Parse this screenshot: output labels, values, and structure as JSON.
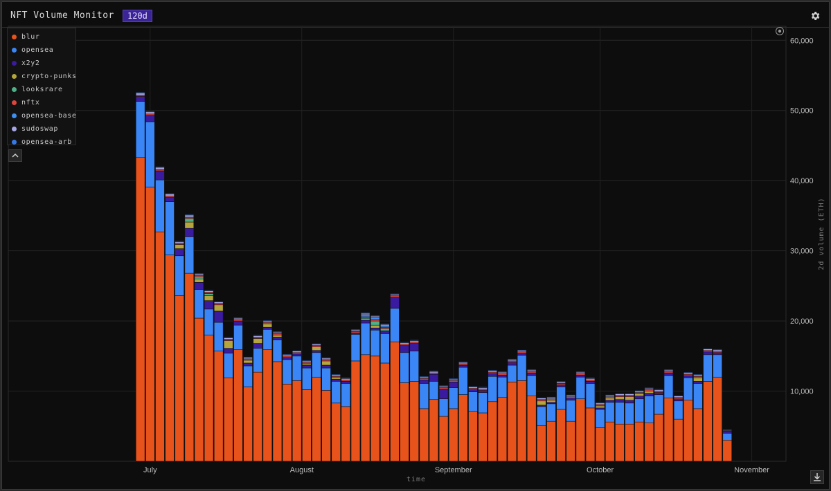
{
  "header": {
    "title": "NFT Volume Monitor",
    "range": "120d"
  },
  "icons": {
    "settings": "gear-icon",
    "collapse": "chevron-up-icon",
    "download": "download-icon",
    "reset": "target-icon"
  },
  "legend": [
    {
      "name": "blur",
      "color": "#e8531c"
    },
    {
      "name": "opensea",
      "color": "#3a86f7"
    },
    {
      "name": "x2y2",
      "color": "#3a1a9e"
    },
    {
      "name": "crypto-punks",
      "color": "#b4a53c"
    },
    {
      "name": "looksrare",
      "color": "#4fb088"
    },
    {
      "name": "nftx",
      "color": "#e0443e"
    },
    {
      "name": "opensea-base",
      "color": "#3f8ef2"
    },
    {
      "name": "sudoswap",
      "color": "#a8a6e6"
    },
    {
      "name": "opensea-arb",
      "color": "#3479ea"
    }
  ],
  "chart_data": {
    "type": "bar",
    "stacked": true,
    "xlabel": "time",
    "ylabel": "2d volume (ETH)",
    "ylim": [
      0,
      62000
    ],
    "y_ticks": [
      "10,000",
      "20,000",
      "30,000",
      "40,000",
      "50,000",
      "60,000"
    ],
    "y_tick_values": [
      10000,
      20000,
      30000,
      40000,
      50000,
      60000
    ],
    "x_ticks": [
      "July",
      "August",
      "September",
      "October",
      "November"
    ],
    "x_tick_dates": [
      "2023-07-01",
      "2023-08-01",
      "2023-09-01",
      "2023-10-01",
      "2023-11-01"
    ],
    "x_range": [
      "2023-06-02",
      "2023-11-08"
    ],
    "grid": true,
    "legend_position": "top-left",
    "categories": [
      "2023-06-29",
      "2023-07-01",
      "2023-07-03",
      "2023-07-05",
      "2023-07-07",
      "2023-07-09",
      "2023-07-11",
      "2023-07-13",
      "2023-07-15",
      "2023-07-17",
      "2023-07-19",
      "2023-07-21",
      "2023-07-23",
      "2023-07-25",
      "2023-07-27",
      "2023-07-29",
      "2023-07-31",
      "2023-08-02",
      "2023-08-04",
      "2023-08-06",
      "2023-08-08",
      "2023-08-10",
      "2023-08-12",
      "2023-08-14",
      "2023-08-16",
      "2023-08-18",
      "2023-08-20",
      "2023-08-22",
      "2023-08-24",
      "2023-08-26",
      "2023-08-28",
      "2023-08-30",
      "2023-09-01",
      "2023-09-03",
      "2023-09-05",
      "2023-09-07",
      "2023-09-09",
      "2023-09-11",
      "2023-09-13",
      "2023-09-15",
      "2023-09-17",
      "2023-09-19",
      "2023-09-21",
      "2023-09-23",
      "2023-09-25",
      "2023-09-27",
      "2023-09-29",
      "2023-10-01",
      "2023-10-03",
      "2023-10-05",
      "2023-10-07",
      "2023-10-09",
      "2023-10-11",
      "2023-10-13",
      "2023-10-15",
      "2023-10-17",
      "2023-10-19",
      "2023-10-21",
      "2023-10-23",
      "2023-10-25",
      "2023-10-27",
      "2023-10-29",
      "2023-10-31"
    ],
    "series": [
      {
        "name": "blur",
        "color": "#e8531c",
        "values": [
          43300,
          39100,
          32700,
          29400,
          23600,
          26800,
          20400,
          18000,
          15700,
          11900,
          15900,
          10600,
          12700,
          15900,
          14200,
          11000,
          11500,
          10200,
          12000,
          10100,
          8300,
          7800,
          14300,
          15200,
          15000,
          14000,
          17000,
          11200,
          11400,
          7500,
          8800,
          6400,
          7500,
          9500,
          7100,
          6900,
          8500,
          9100,
          11300,
          11500,
          9300,
          5100,
          5700,
          7400,
          5700,
          8900,
          7600,
          4800,
          5600,
          5300,
          5300,
          5600,
          5500,
          6700,
          9000,
          6000,
          8700,
          7500,
          11400,
          12000,
          3000,
          0,
          0
        ]
      },
      {
        "name": "opensea",
        "color": "#3a86f7",
        "values": [
          8000,
          9300,
          7400,
          7600,
          5700,
          5200,
          4100,
          3700,
          4100,
          3500,
          3500,
          3000,
          3400,
          2900,
          3100,
          3500,
          3500,
          3100,
          3500,
          3200,
          3100,
          3300,
          3800,
          4500,
          3700,
          4200,
          4800,
          4300,
          4300,
          3600,
          2600,
          2500,
          3000,
          3900,
          2800,
          2900,
          3600,
          2900,
          2400,
          3600,
          2900,
          2700,
          2500,
          3200,
          3000,
          3100,
          3500,
          2600,
          2800,
          3100,
          3000,
          3300,
          3800,
          2800,
          3200,
          2600,
          3200,
          3600,
          3800,
          3200,
          1000,
          0,
          0
        ]
      },
      {
        "name": "x2y2",
        "color": "#3a1a9e",
        "values": [
          700,
          900,
          1300,
          600,
          1000,
          1200,
          1000,
          1200,
          1600,
          700,
          600,
          400,
          700,
          300,
          400,
          300,
          300,
          400,
          300,
          400,
          300,
          300,
          200,
          400,
          300,
          400,
          1600,
          1000,
          1100,
          500,
          1000,
          1400,
          800,
          300,
          300,
          300,
          400,
          300,
          400,
          300,
          400,
          200,
          200,
          300,
          300,
          300,
          300,
          200,
          300,
          400,
          400,
          400,
          400,
          300,
          400,
          300,
          300,
          300,
          400,
          300,
          200,
          0,
          0
        ]
      },
      {
        "name": "crypto-punks",
        "color": "#b4a53c",
        "values": [
          0,
          0,
          0,
          0,
          600,
          900,
          500,
          700,
          900,
          1100,
          0,
          400,
          700,
          500,
          300,
          0,
          0,
          200,
          500,
          600,
          200,
          0,
          0,
          0,
          400,
          0,
          0,
          0,
          0,
          0,
          0,
          0,
          0,
          0,
          0,
          0,
          0,
          0,
          0,
          0,
          0,
          600,
          300,
          0,
          0,
          0,
          0,
          300,
          300,
          400,
          500,
          300,
          300,
          0,
          0,
          0,
          0,
          500,
          0,
          0,
          0,
          0,
          0
        ]
      },
      {
        "name": "looksrare",
        "color": "#4fb088",
        "values": [
          0,
          0,
          0,
          0,
          0,
          500,
          300,
          300,
          0,
          0,
          0,
          0,
          0,
          0,
          0,
          0,
          0,
          0,
          0,
          0,
          0,
          0,
          0,
          300,
          600,
          300,
          0,
          0,
          0,
          0,
          0,
          0,
          0,
          0,
          0,
          0,
          0,
          0,
          0,
          0,
          0,
          0,
          0,
          0,
          0,
          0,
          0,
          0,
          0,
          0,
          0,
          0,
          0,
          0,
          0,
          0,
          0,
          0,
          0,
          0,
          0,
          0,
          0
        ]
      },
      {
        "name": "nftx",
        "color": "#e0443e",
        "values": [
          200,
          200,
          200,
          200,
          200,
          200,
          200,
          200,
          200,
          200,
          200,
          200,
          200,
          200,
          200,
          200,
          200,
          200,
          200,
          200,
          200,
          200,
          200,
          200,
          200,
          200,
          200,
          200,
          200,
          200,
          200,
          200,
          200,
          200,
          200,
          200,
          200,
          200,
          200,
          200,
          200,
          200,
          200,
          200,
          200,
          200,
          200,
          200,
          200,
          200,
          200,
          200,
          200,
          200,
          200,
          200,
          200,
          200,
          200,
          200,
          100,
          0,
          0
        ]
      },
      {
        "name": "opensea-base",
        "color": "#3f8ef2",
        "values": [
          0,
          0,
          0,
          0,
          0,
          0,
          0,
          0,
          0,
          0,
          0,
          0,
          0,
          0,
          0,
          0,
          0,
          0,
          0,
          0,
          0,
          0,
          0,
          300,
          300,
          200,
          0,
          0,
          0,
          0,
          0,
          0,
          0,
          0,
          0,
          0,
          0,
          0,
          0,
          0,
          0,
          0,
          0,
          0,
          0,
          0,
          0,
          0,
          0,
          0,
          0,
          0,
          0,
          0,
          0,
          0,
          0,
          0,
          0,
          0,
          0,
          0,
          0
        ]
      },
      {
        "name": "sudoswap",
        "color": "#a8a6e6",
        "values": [
          300,
          300,
          300,
          300,
          200,
          300,
          200,
          200,
          200,
          200,
          200,
          200,
          200,
          200,
          200,
          200,
          200,
          200,
          200,
          200,
          200,
          200,
          200,
          200,
          200,
          200,
          200,
          200,
          200,
          200,
          200,
          200,
          200,
          200,
          200,
          200,
          200,
          200,
          200,
          200,
          200,
          200,
          200,
          200,
          200,
          200,
          200,
          200,
          200,
          200,
          200,
          200,
          200,
          200,
          200,
          200,
          200,
          200,
          200,
          200,
          100,
          0,
          0
        ]
      },
      {
        "name": "opensea-arb",
        "color": "#3479ea",
        "values": [
          100,
          100,
          100,
          100,
          100,
          100,
          100,
          100,
          100,
          100,
          100,
          100,
          100,
          100,
          100,
          100,
          100,
          100,
          100,
          100,
          100,
          100,
          100,
          100,
          100,
          100,
          100,
          100,
          100,
          100,
          100,
          100,
          100,
          100,
          100,
          100,
          100,
          100,
          100,
          100,
          100,
          100,
          100,
          100,
          100,
          100,
          100,
          100,
          100,
          100,
          100,
          100,
          100,
          100,
          100,
          100,
          100,
          100,
          100,
          100,
          100,
          0,
          0
        ]
      }
    ]
  }
}
